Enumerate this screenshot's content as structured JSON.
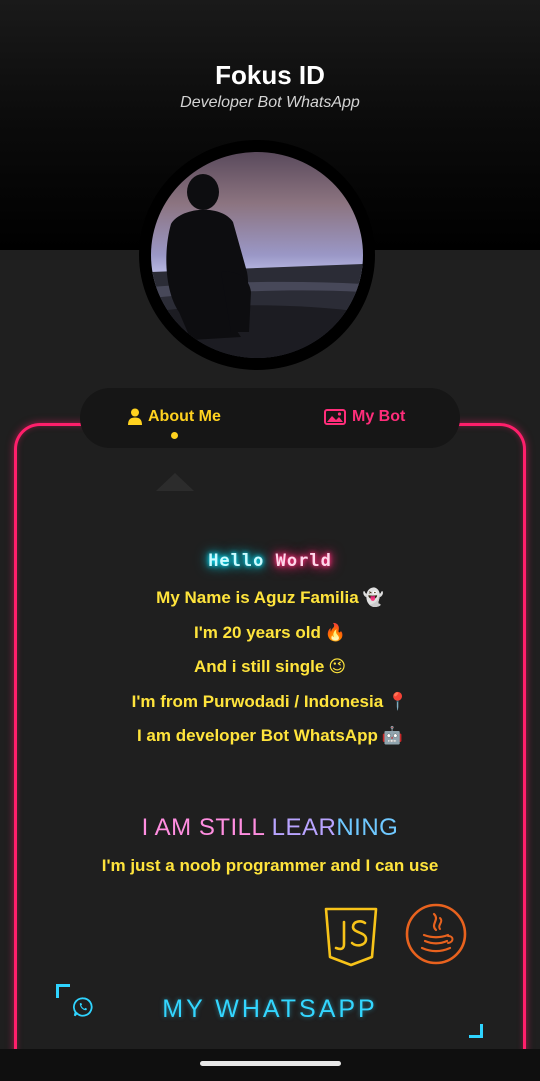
{
  "header": {
    "title": "Fokus ID",
    "subtitle": "Developer Bot WhatsApp"
  },
  "tabs": [
    {
      "label": "About Me",
      "icon": "user-icon",
      "color": "#ffd21f",
      "active": true
    },
    {
      "label": "My Bot",
      "icon": "image-icon",
      "color": "#ff2d7a",
      "active": false
    }
  ],
  "about": {
    "greeting_part1": "Hello",
    "greeting_part2": "World",
    "lines": [
      {
        "text": "My Name is Aguz Familia",
        "emoji": "👻"
      },
      {
        "text": "I'm 20 years old",
        "emoji": "🔥"
      },
      {
        "text": "And i still single",
        "emoji": "😉"
      },
      {
        "text": "I'm from Purwodadi / Indonesia",
        "emoji": "📍"
      },
      {
        "text": "I am developer Bot WhatsApp",
        "emoji": "🤖"
      }
    ]
  },
  "learning": {
    "title_part1": "I AM STILL ",
    "title_part2": "LEAR",
    "title_part3": "NING",
    "caption": "I'm just a noob programmer and I can use",
    "skill_icons": [
      "javascript-icon",
      "java-icon"
    ]
  },
  "whatsapp": {
    "title": "MY WHATSAPP",
    "icon": "whatsapp-icon"
  },
  "colors": {
    "accent_yellow": "#ffe43c",
    "neon_pink": "#ff1f6b",
    "neon_cyan": "#33d6ff"
  }
}
